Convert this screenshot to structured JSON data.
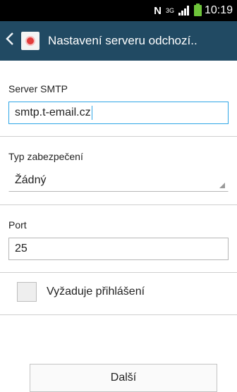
{
  "status_bar": {
    "nfc_icon": "N",
    "network_type": "3G",
    "time": "10:19"
  },
  "action_bar": {
    "title": "Nastavení serveru odchozí.."
  },
  "form": {
    "smtp_server": {
      "label": "Server SMTP",
      "value": "smtp.t-email.cz"
    },
    "security_type": {
      "label": "Typ zabezpečení",
      "value": "Žádný"
    },
    "port": {
      "label": "Port",
      "value": "25"
    },
    "require_login": {
      "label": "Vyžaduje přihlášení",
      "checked": false
    }
  },
  "buttons": {
    "next_label": "Další"
  },
  "colors": {
    "action_bar_bg": "#214a63",
    "focus_accent": "#2fa6e6",
    "battery": "#6ec43a"
  }
}
